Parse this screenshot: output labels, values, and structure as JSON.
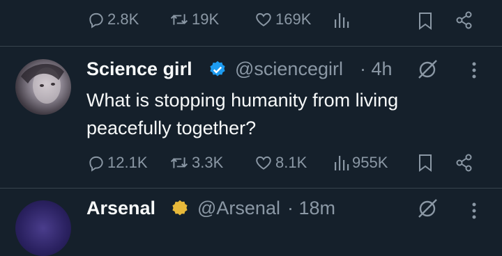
{
  "top_tweet_actions": {
    "replies": "2.8K",
    "reposts": "19K",
    "likes": "169K"
  },
  "tweet": {
    "display_name": "Science girl",
    "handle": "@sciencegirl",
    "time": "· 4h",
    "text": "What is stopping humanity from living peacefully together?",
    "verified_color": "#1d9bf0",
    "actions": {
      "replies": "12.1K",
      "reposts": "3.3K",
      "likes": "8.1K",
      "views": "955K"
    }
  },
  "next_tweet": {
    "display_name": "Arsenal",
    "handle": "@Arsenal",
    "time": "· 18m",
    "verified_color": "#e8b93a"
  },
  "colors": {
    "background": "#15202b",
    "text": "#f7f9f9",
    "muted": "#8b98a5",
    "divider": "#38444d"
  }
}
